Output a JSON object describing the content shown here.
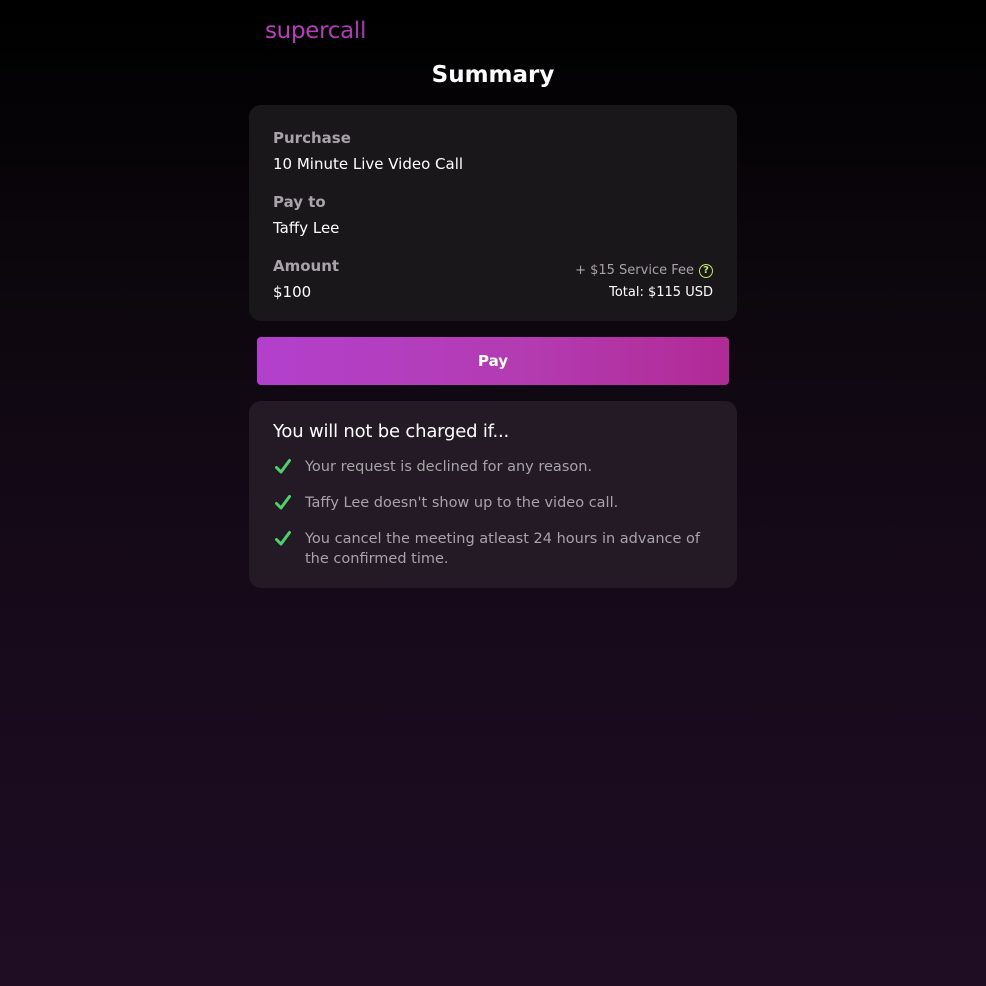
{
  "brand": {
    "logo_text": "supercall"
  },
  "page": {
    "title": "Summary"
  },
  "summary": {
    "purchase_label": "Purchase",
    "purchase_value": "10 Minute Live Video Call",
    "payto_label": "Pay to",
    "payto_value": "Taffy Lee",
    "amount_label": "Amount",
    "amount_value": "$100",
    "service_fee": "+ $15 Service Fee",
    "total": "Total: $115 USD",
    "help_icon": "question-circle-icon"
  },
  "pay_button": {
    "label": "Pay"
  },
  "no_charge": {
    "heading": "You will not be charged if...",
    "items": [
      "Your request is declined for any reason.",
      "Taffy Lee doesn't show up to the video call.",
      "You cancel the meeting atleast 24 hours in advance of the confirmed time."
    ],
    "item_icon": "checkmark-icon"
  },
  "colors": {
    "accent_start": "#b340cc",
    "accent_end": "#b12a96",
    "check_green": "#4ed16a",
    "help_icon_color": "#bfe86a"
  }
}
